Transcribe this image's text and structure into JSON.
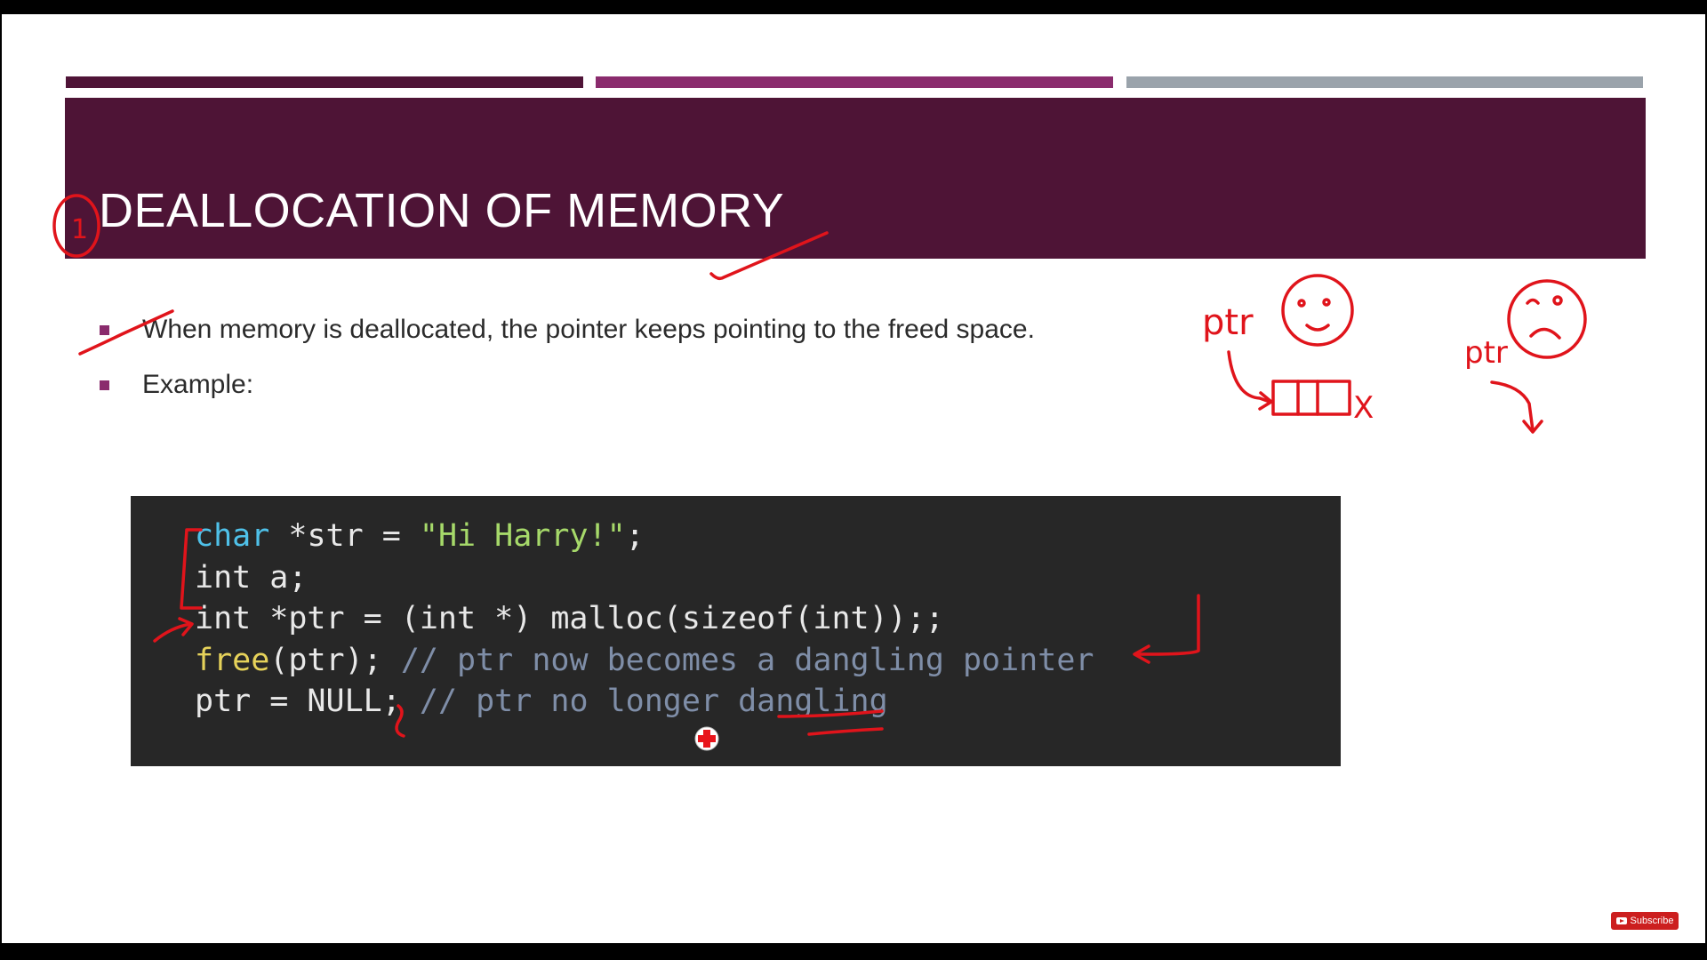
{
  "slide": {
    "title": "DEALLOCATION OF MEMORY",
    "bullets": [
      "When memory is deallocated, the pointer keeps pointing to the freed space.",
      "Example:"
    ]
  },
  "code": {
    "lines": [
      [
        {
          "t": "char",
          "k": "type"
        },
        {
          "t": " *str = ",
          "k": "plain"
        },
        {
          "t": "\"Hi Harry!\"",
          "k": "str"
        },
        {
          "t": ";",
          "k": "plain"
        }
      ],
      [
        {
          "t": "int a;",
          "k": "plain"
        }
      ],
      [
        {
          "t": "int *ptr = (int *) malloc(sizeof(int));;",
          "k": "plain"
        }
      ],
      [
        {
          "t": "free",
          "k": "fn"
        },
        {
          "t": "(ptr); ",
          "k": "plain"
        },
        {
          "t": "// ptr now becomes a dangling pointer",
          "k": "cmt"
        }
      ],
      [
        {
          "t": "ptr = NULL; ",
          "k": "plain"
        },
        {
          "t": "// ptr no longer dangling",
          "k": "cmt"
        }
      ]
    ]
  },
  "annotations": {
    "number_label": "1",
    "ptr_label_1": "ptr",
    "ptr_label_2": "ptr",
    "x_mark": "X"
  },
  "subscribe": {
    "label": "Subscribe"
  },
  "colors": {
    "title_band": "#4e1436",
    "accent": "#8a2b6d",
    "annotation_ink": "#e0141b"
  }
}
